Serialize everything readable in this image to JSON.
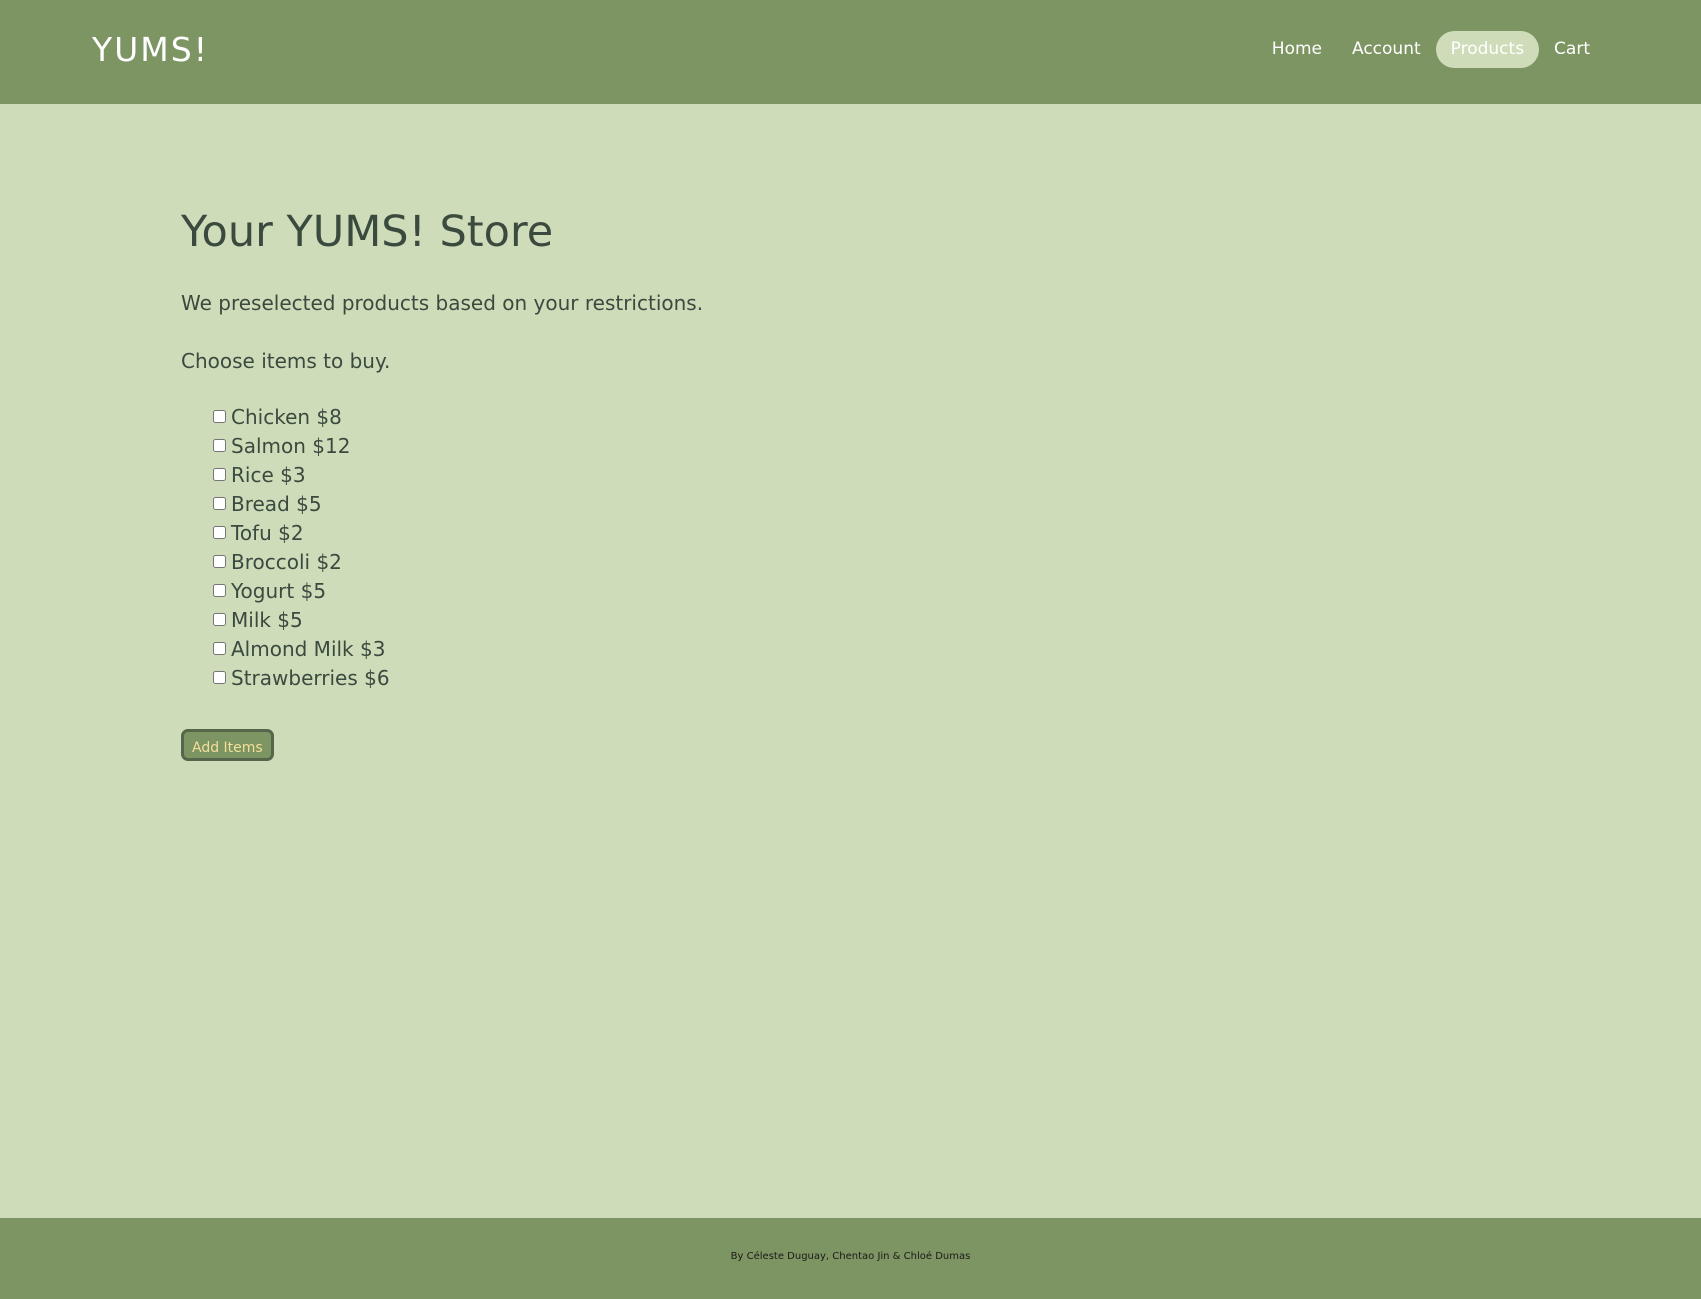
{
  "header": {
    "logo": "YUMS!",
    "nav": [
      {
        "label": "Home",
        "active": false
      },
      {
        "label": "Account",
        "active": false
      },
      {
        "label": "Products",
        "active": true
      },
      {
        "label": "Cart",
        "active": false
      }
    ]
  },
  "main": {
    "title": "Your YUMS! Store",
    "intro": "We preselected products based on your restrictions.",
    "choose": "Choose items to buy.",
    "products": [
      {
        "label": "Chicken $8",
        "checked": false
      },
      {
        "label": "Salmon $12",
        "checked": false
      },
      {
        "label": "Rice $3",
        "checked": false
      },
      {
        "label": "Bread $5",
        "checked": false
      },
      {
        "label": "Tofu $2",
        "checked": false
      },
      {
        "label": "Broccoli $2",
        "checked": false
      },
      {
        "label": "Yogurt $5",
        "checked": false
      },
      {
        "label": "Milk $5",
        "checked": false
      },
      {
        "label": "Almond Milk $3",
        "checked": false
      },
      {
        "label": "Strawberries $6",
        "checked": false
      }
    ],
    "add_button_label": "Add Items"
  },
  "footer": {
    "credits": "By Céleste Duguay, Chentao Jin & Chloé Dumas"
  },
  "colors": {
    "header_bg": "#7d9562",
    "page_bg": "#cedcb9",
    "text": "#3b4a3f",
    "button_text": "#f3df9a"
  }
}
